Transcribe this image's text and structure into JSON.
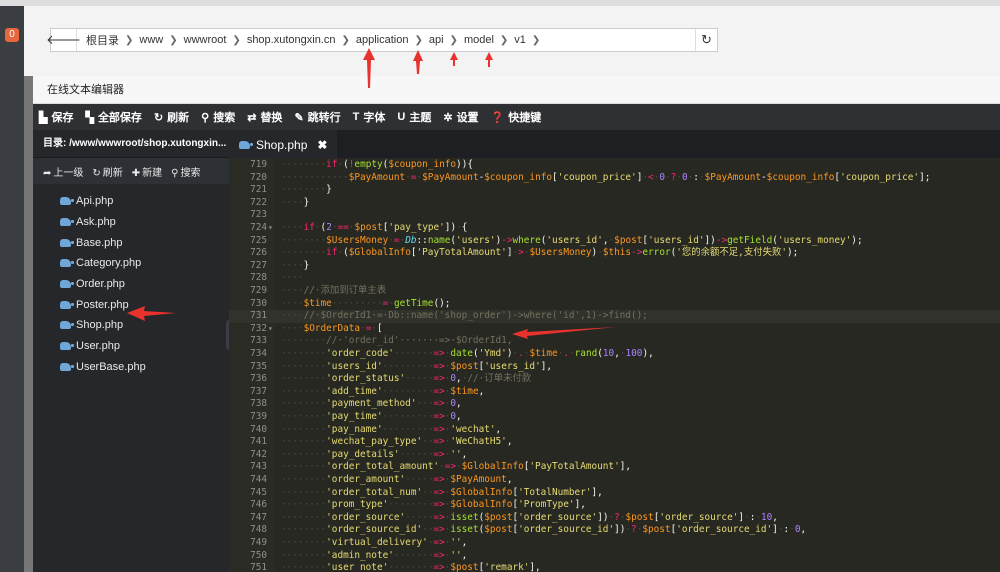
{
  "notification_badge": "0",
  "breadcrumb": {
    "back_icon": "arrow-left-icon",
    "items": [
      "根目录",
      "www",
      "wwwroot",
      "shop.xutongxin.cn",
      "application",
      "api",
      "model",
      "v1"
    ],
    "refresh_icon": "refresh-icon"
  },
  "editor": {
    "title": "在线文本编辑器",
    "toolbar": [
      {
        "label": "保存",
        "icon": "save-icon"
      },
      {
        "label": "全部保存",
        "icon": "save-all-icon"
      },
      {
        "label": "刷新",
        "icon": "refresh-icon"
      },
      {
        "label": "搜索",
        "icon": "search-icon"
      },
      {
        "label": "替换",
        "icon": "replace-icon"
      },
      {
        "label": "跳转行",
        "icon": "goto-line-icon"
      },
      {
        "label": "字体",
        "icon": "font-icon"
      },
      {
        "label": "主题",
        "icon": "theme-icon"
      },
      {
        "label": "设置",
        "icon": "gear-icon"
      },
      {
        "label": "快捷键",
        "icon": "help-icon"
      }
    ],
    "toolbar_glyphs": [
      "▙",
      "▚",
      "↻",
      "⚲",
      "⇄",
      "✎",
      "T",
      "U",
      "✲",
      "❓"
    ],
    "sidebar": {
      "path": "目录: /www/wwwroot/shop.xutongxin...",
      "tools": [
        {
          "label": "上一级",
          "icon": "arrow-up-icon",
          "glyph": "➦"
        },
        {
          "label": "刷新",
          "icon": "refresh-icon",
          "glyph": "↻"
        },
        {
          "label": "新建",
          "icon": "plus-icon",
          "glyph": "✚"
        },
        {
          "label": "搜索",
          "icon": "search-icon",
          "glyph": "⚲"
        }
      ],
      "files": [
        "Api.php",
        "Ask.php",
        "Base.php",
        "Category.php",
        "Order.php",
        "Poster.php",
        "Shop.php",
        "User.php",
        "UserBase.php"
      ]
    },
    "tab": {
      "label": "Shop.php",
      "close": "✖"
    },
    "collapse_glyph": "❮"
  },
  "code": {
    "active_line": 731,
    "lines": [
      {
        "n": 719,
        "t": "········if·(!empty($coupon_info)){"
      },
      {
        "n": 720,
        "t": "············$PayAmount·=·$PayAmount-$coupon_info['coupon_price']·<·0·?·0·:·$PayAmount-$coupon_info['coupon_price'];"
      },
      {
        "n": 721,
        "t": "········}"
      },
      {
        "n": 722,
        "t": "····}"
      },
      {
        "n": 723,
        "t": ""
      },
      {
        "n": 724,
        "t": "····if·(2·==·$post['pay_type'])·{"
      },
      {
        "n": 725,
        "t": "········$UsersMoney·=·Db::name('users')->where('users_id',·$post['users_id'])->getField('users_money');"
      },
      {
        "n": 726,
        "t": "········if·($GlobalInfo['PayTotalAmount']·>·$UsersMoney)·$this->error('您的余额不足,支付失败');"
      },
      {
        "n": 727,
        "t": "····}"
      },
      {
        "n": 728,
        "t": "····"
      },
      {
        "n": 729,
        "t": "····//·添加到订单主表"
      },
      {
        "n": 730,
        "t": "····$time·········=·getTime();"
      },
      {
        "n": 731,
        "t": "····//·$OrderId1·=·Db::name('shop_order')->where('id',1)->find();"
      },
      {
        "n": 732,
        "t": "····$OrderData·=·["
      },
      {
        "n": 733,
        "t": "········//·'order_id'·······=>·$OrderId1,"
      },
      {
        "n": 734,
        "t": "········'order_code'·······=>·date('Ymd')·.·$time·.·rand(10,·100),"
      },
      {
        "n": 735,
        "t": "········'users_id'·········=>·$post['users_id'],"
      },
      {
        "n": 736,
        "t": "········'order_status'·····=>·0,·//·订单未付款"
      },
      {
        "n": 737,
        "t": "········'add_time'·········=>·$time,"
      },
      {
        "n": 738,
        "t": "········'payment_method'···=>·0,"
      },
      {
        "n": 739,
        "t": "········'pay_time'·········=>·0,"
      },
      {
        "n": 740,
        "t": "········'pay_name'·········=>·'wechat',"
      },
      {
        "n": 741,
        "t": "········'wechat_pay_type'··=>·'WeChatH5',"
      },
      {
        "n": 742,
        "t": "········'pay_details'······=>·'',"
      },
      {
        "n": 743,
        "t": "········'order_total_amount'·=>·$GlobalInfo['PayTotalAmount'],"
      },
      {
        "n": 744,
        "t": "········'order_amount'·····=>·$PayAmount,"
      },
      {
        "n": 745,
        "t": "········'order_total_num'··=>·$GlobalInfo['TotalNumber'],"
      },
      {
        "n": 746,
        "t": "········'prom_type'········=>·$GlobalInfo['PromType'],"
      },
      {
        "n": 747,
        "t": "········'order_source'·····=>·isset($post['order_source'])·?·$post['order_source']·:·10,"
      },
      {
        "n": 748,
        "t": "········'order_source_id'··=>·isset($post['order_source_id'])·?·$post['order_source_id']·:·0,"
      },
      {
        "n": 749,
        "t": "········'virtual_delivery'·=>·'',"
      },
      {
        "n": 750,
        "t": "········'admin_note'·······=>·'',"
      },
      {
        "n": 751,
        "t": "········'user_note'········=>·$post['remark'],"
      }
    ]
  },
  "colors": {
    "annotation_arrow": "#e8322e",
    "toolbar_bg": "#2e3033",
    "sidebar_bg": "#25272b",
    "code_bg": "#272822"
  }
}
